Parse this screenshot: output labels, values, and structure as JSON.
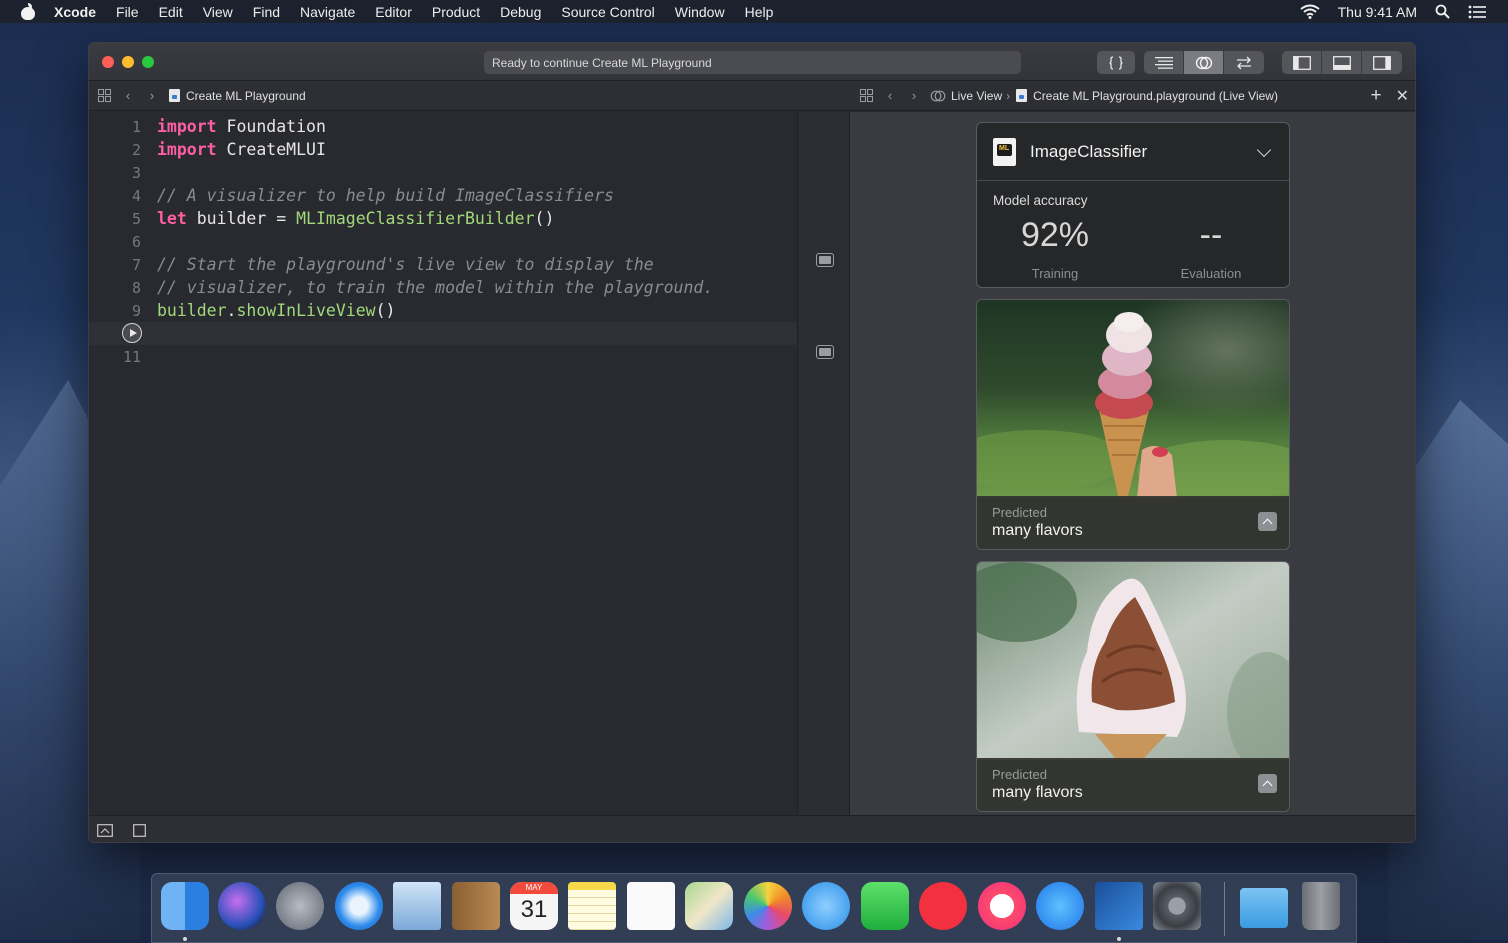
{
  "menubar": {
    "app_name": "Xcode",
    "items": [
      "File",
      "Edit",
      "View",
      "Find",
      "Navigate",
      "Editor",
      "Product",
      "Debug",
      "Source Control",
      "Window",
      "Help"
    ],
    "clock": "Thu 9:41 AM"
  },
  "window": {
    "status": "Ready to continue Create ML Playground",
    "left_jumpbar": {
      "file": "Create ML Playground"
    },
    "right_jumpbar": {
      "crumb1": "Live View",
      "crumb2": "Create ML Playground.playground (Live View)"
    }
  },
  "editor": {
    "lines": [
      {
        "num": "1"
      },
      {
        "num": "2"
      },
      {
        "num": "3"
      },
      {
        "num": "4"
      },
      {
        "num": "5"
      },
      {
        "num": "6"
      },
      {
        "num": "7"
      },
      {
        "num": "8"
      },
      {
        "num": "9"
      },
      {
        "num": ""
      },
      {
        "num": "11"
      }
    ],
    "tokens": {
      "import": "import",
      "foundation": "Foundation",
      "createmlui": "CreateMLUI",
      "comment1": "// A visualizer to help build ImageClassifiers",
      "let": "let",
      "builder_decl": "builder = ",
      "builder_type": "MLImageClassifierBuilder",
      "parens": "()",
      "comment2": "// Start the playground's live view to display the",
      "comment3": "// visualizer, to train the model within the playground.",
      "builder_var": "builder",
      "dot": ".",
      "show_fn": "showInLiveView",
      "parens2": "()"
    }
  },
  "liveview": {
    "classifier": {
      "title": "ImageClassifier",
      "icon_text": "ML",
      "accuracy_label": "Model accuracy",
      "training_value": "92%",
      "training_label": "Training",
      "evaluation_value": "--",
      "evaluation_label": "Evaluation"
    },
    "predictions": [
      {
        "label": "Predicted",
        "value": "many flavors"
      },
      {
        "label": "Predicted",
        "value": "many flavors"
      }
    ]
  },
  "dock": {
    "apps": [
      "finder-icon",
      "siri-icon",
      "launchpad-icon",
      "safari-icon",
      "mail-icon",
      "contacts-icon",
      "calendar-icon",
      "notes-icon",
      "reminders-icon",
      "maps-icon",
      "photos-icon",
      "messages-icon",
      "facetime-icon",
      "news-icon",
      "music-icon",
      "app-store-icon",
      "xcode-icon",
      "system-preferences-icon",
      "downloads-folder-icon",
      "trash-icon"
    ],
    "calendar_month": "MAY",
    "calendar_day": "31"
  },
  "colors": {
    "keyword": "#fc5fa3",
    "type": "#a1d97a",
    "comment": "#8a8b90",
    "editor_bg": "#292a30"
  }
}
